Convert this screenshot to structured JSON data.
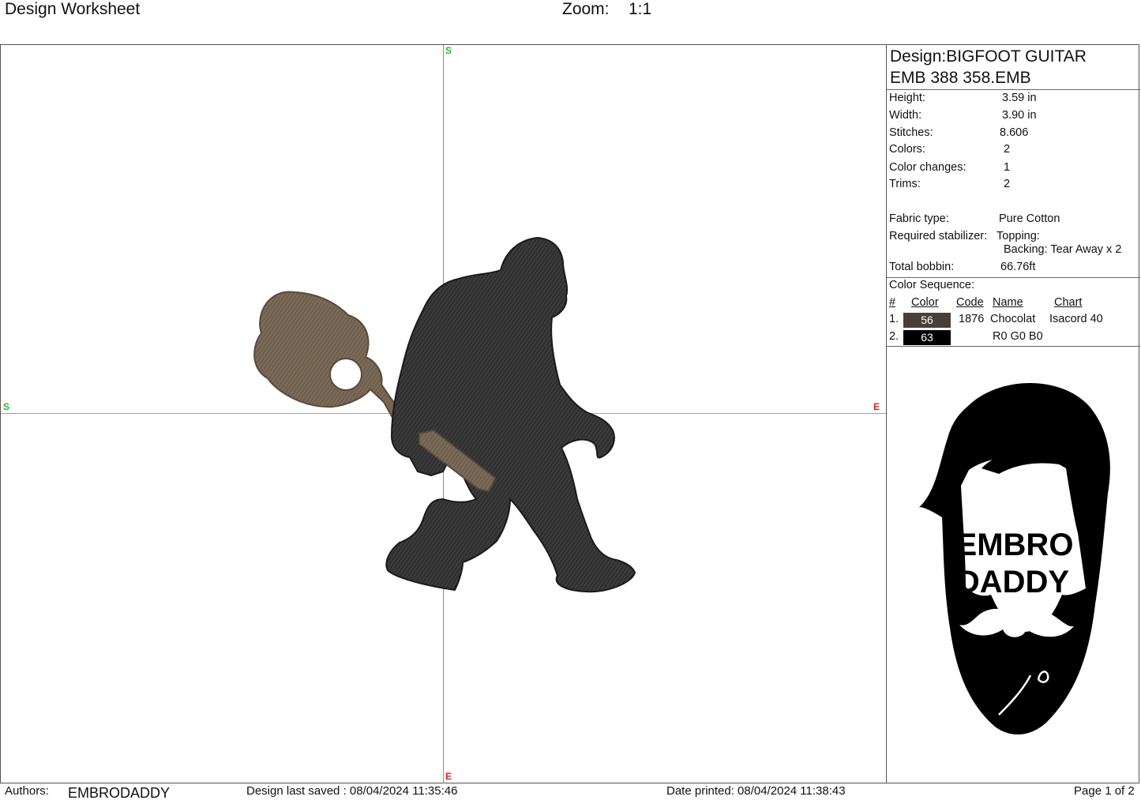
{
  "header": {
    "title": "Design Worksheet",
    "zoom_label": "Zoom:",
    "zoom_value": "1:1"
  },
  "canvas": {
    "axis_start_label": "S",
    "axis_end_label": "E",
    "axis_colors": {
      "horizontal": "#c79a4e",
      "vertical": "#c07a5e",
      "start": "#2db32d",
      "end": "#d02020"
    }
  },
  "design": {
    "name_line1": "Design:BIGFOOT GUITAR",
    "name_line2": "EMB 388 358.EMB",
    "stats": [
      {
        "label": "Height:",
        "value": "3.59 in"
      },
      {
        "label": "Width:",
        "value": "3.90 in"
      },
      {
        "label": "Stitches:",
        "value": "8.606"
      },
      {
        "label": "Colors:",
        "value": "2"
      },
      {
        "label": "Color changes:",
        "value": "1"
      },
      {
        "label": "Trims:",
        "value": "2"
      }
    ],
    "fabric_label": "Fabric type:",
    "fabric_value": "Pure Cotton",
    "stabilizer_label": "Required stabilizer:",
    "topping": "Topping:",
    "backing": "Backing: Tear Away x 2",
    "bobbin_label": "Total bobbin:",
    "bobbin_value": "66.76ft"
  },
  "color_sequence": {
    "title": "Color Sequence:",
    "headers": {
      "num": "#",
      "color": "Color",
      "code": "Code",
      "name": "Name",
      "chart": "Chart"
    },
    "rows": [
      {
        "num": "1.",
        "color": "56",
        "hex": "#4a3f36",
        "code": "1876",
        "name": "Chocolat",
        "chart": "Isacord 40"
      },
      {
        "num": "2.",
        "color": "63",
        "hex": "#000000",
        "code": "",
        "name": "R0 G0 B0",
        "chart": ""
      }
    ]
  },
  "logo": {
    "line1": "EMBRO",
    "line2": "DADDY"
  },
  "footer": {
    "authors_label": "Authors:",
    "authors_value": "EMBRODADDY",
    "saved": "Design last saved : 08/04/2024 11:35:46",
    "printed": "Date printed: 08/04/2024 11:38:43",
    "page": "Page 1 of 2"
  }
}
